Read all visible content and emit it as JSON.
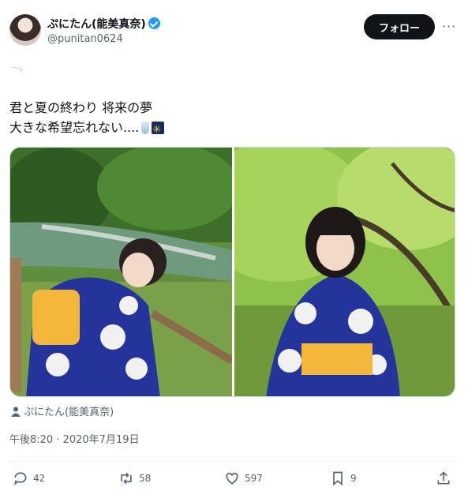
{
  "author": {
    "display_name": "ぷにたん(能美真奈)",
    "handle": "@punitan0624",
    "verified": true
  },
  "follow_label": "フォロー",
  "more_label": "···",
  "tiny_text": "ﾞ⌒ᵕ̈)",
  "tweet": {
    "line1": "君と夏の終わり 将来の夢",
    "line2": "大きな希望忘れない....",
    "emoji": [
      "bottle-emoji",
      "sparkler-emoji"
    ]
  },
  "media_caption": "ぷにたん(能美真奈)",
  "timestamp": "午後8:20 · 2020年7月19日",
  "actions": {
    "replies": "42",
    "retweets": "58",
    "likes": "597",
    "bookmarks": "9"
  },
  "colors": {
    "accent": "#1d9bf0",
    "text_secondary": "#536471",
    "button_dark": "#0f1419"
  }
}
